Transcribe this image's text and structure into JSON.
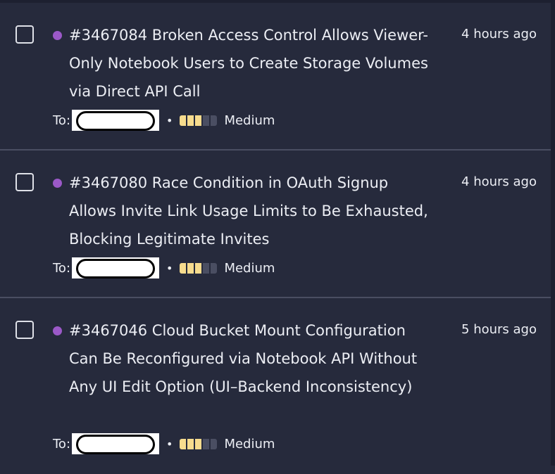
{
  "reports": [
    {
      "id_title": "#3467084 Broken Access Control Allows Viewer-Only Notebook Users to Create Storage Volumes via Direct API Call",
      "time": "4 hours ago",
      "to_label": "To:",
      "separator": "•",
      "severity": {
        "label": "Medium",
        "level": 3,
        "max": 5
      }
    },
    {
      "id_title": "#3467080 Race Condition in OAuth Signup Allows Invite Link Usage Limits to Be Exhausted, Blocking Legitimate Invites",
      "time": "4 hours ago",
      "to_label": "To:",
      "separator": "•",
      "severity": {
        "label": "Medium",
        "level": 3,
        "max": 5
      }
    },
    {
      "id_title": "#3467046 Cloud Bucket Mount Configuration Can Be Reconfigured via Notebook API Without Any UI Edit Option (UI–Backend Inconsistency)",
      "time": "5 hours ago",
      "to_label": "To:",
      "separator": "•",
      "severity": {
        "label": "Medium",
        "level": 3,
        "max": 5
      }
    }
  ],
  "colors": {
    "background": "#262a3c",
    "status_dot": "#9b59c8",
    "severity_on": "#f7dc8e",
    "severity_off": "#4a4e62",
    "divider": "#4a4e62"
  }
}
